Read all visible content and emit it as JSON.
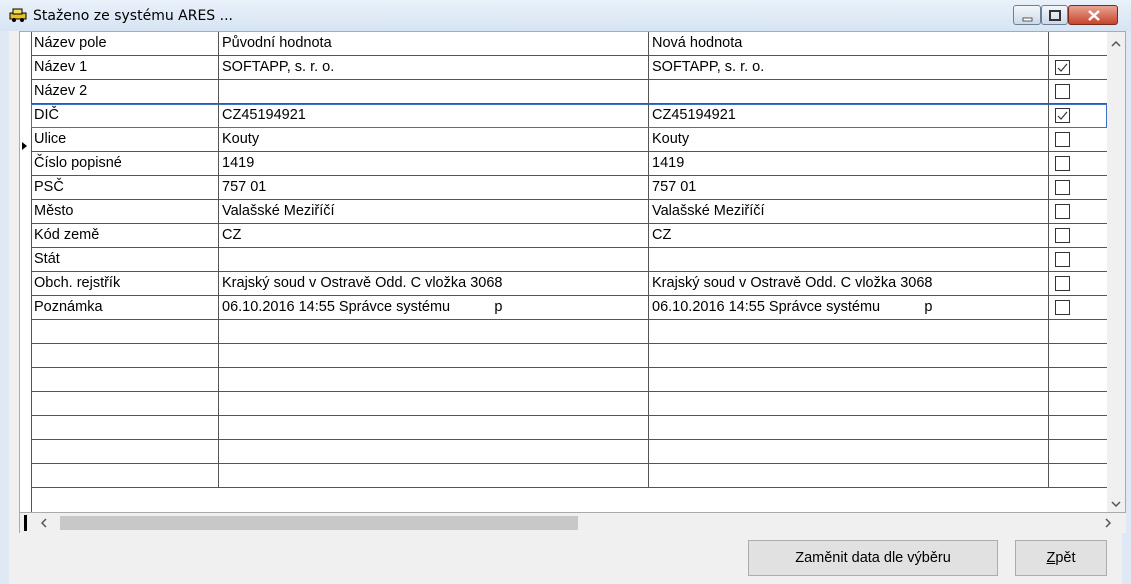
{
  "window": {
    "title": "Staženo ze systému ARES ..."
  },
  "grid": {
    "headers": [
      "Název pole",
      "Původní hodnota",
      "Nová hodnota",
      ""
    ],
    "rows": [
      {
        "field": "Název 1",
        "old": "SOFTAPP, s. r. o.",
        "new": "SOFTAPP, s. r. o.",
        "checked": true
      },
      {
        "field": "Název 2",
        "old": "",
        "new": "",
        "checked": false
      },
      {
        "field": "DIČ",
        "old": "CZ45194921",
        "new": "CZ45194921",
        "checked": true
      },
      {
        "field": "Ulice",
        "old": "Kouty",
        "new": "Kouty",
        "checked": false
      },
      {
        "field": "Číslo popisné",
        "old": "1419",
        "new": "1419",
        "checked": false
      },
      {
        "field": "PSČ",
        "old": "757 01",
        "new": "757 01",
        "checked": false
      },
      {
        "field": "Město",
        "old": "Valašské Meziříčí",
        "new": "Valašské Meziříčí",
        "checked": false
      },
      {
        "field": "Kód země",
        "old": "CZ",
        "new": "CZ",
        "checked": false
      },
      {
        "field": "Stát",
        "old": "",
        "new": "",
        "checked": false
      },
      {
        "field": "Obch. rejstřík",
        "old": "Krajský soud v Ostravě Odd. C vložka 3068",
        "new": "Krajský soud v Ostravě Odd. C vložka 3068",
        "checked": false
      },
      {
        "field": "Poznámka",
        "old": "06.10.2016 14:55 Správce systému           p",
        "new": "06.10.2016 14:55 Správce systému           p",
        "checked": false
      }
    ],
    "selected_row": 2,
    "empty_rows": 7
  },
  "buttons": {
    "replace_label": "Zaměnit data dle výběru",
    "back_label_underlined": "Z",
    "back_label_rest": "pět"
  },
  "icons": {
    "app": "car-icon",
    "minimize": "minimize-icon",
    "maximize": "maximize-icon",
    "close": "close-icon"
  },
  "colors": {
    "selection_outline": "#3b72c8",
    "close_button": "#c7442c"
  }
}
